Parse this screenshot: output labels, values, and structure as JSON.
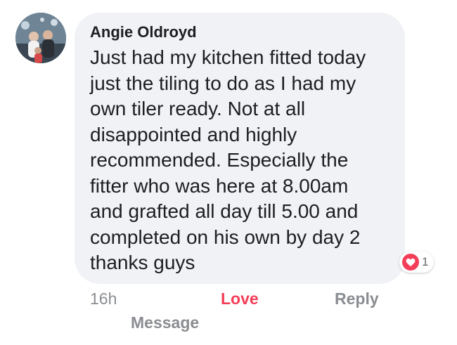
{
  "comment": {
    "author": "Angie Oldroyd",
    "text": "Just had my kitchen fitted today just the tiling to do as I had my own tiler ready. Not at all disappointed and highly recommended. Especially the fitter who was here at 8.00am and grafted all day till 5.00 and completed on his own by day 2 thanks guys",
    "reaction": {
      "icon": "heart-icon",
      "count": "1",
      "color": "#f33e58"
    },
    "actions": {
      "time": "16h",
      "love_label": "Love",
      "reply_label": "Reply",
      "message_label": "Message"
    },
    "colors": {
      "bubble": "#f0f2f5",
      "love": "#f33e58",
      "muted": "#8a8d91"
    }
  }
}
